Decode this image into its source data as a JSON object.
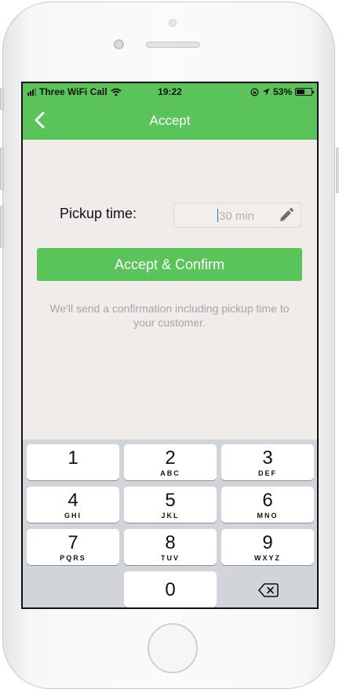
{
  "status_bar": {
    "carrier": "Three WiFi Call",
    "time": "19:22",
    "battery": "53%",
    "battery_level": 0.53,
    "signal_icon": "signal-icon",
    "wifi_icon": "wifi-icon",
    "lock_icon": "orientation-lock-icon",
    "location_icon": "location-arrow-icon"
  },
  "navbar": {
    "title": "Accept",
    "back_icon": "chevron-left-icon"
  },
  "pickup": {
    "label": "Pickup time:",
    "placeholder": "30 min",
    "value": "",
    "edit_icon": "pencil-icon"
  },
  "accept_button": {
    "label": "Accept & Confirm"
  },
  "info_text": "We'll send a confirmation including pickup time to your customer.",
  "keypad": {
    "keys": [
      {
        "num": "1",
        "letters": ""
      },
      {
        "num": "2",
        "letters": "ABC"
      },
      {
        "num": "3",
        "letters": "DEF"
      },
      {
        "num": "4",
        "letters": "GHI"
      },
      {
        "num": "5",
        "letters": "JKL"
      },
      {
        "num": "6",
        "letters": "MNO"
      },
      {
        "num": "7",
        "letters": "PQRS"
      },
      {
        "num": "8",
        "letters": "TUV"
      },
      {
        "num": "9",
        "letters": "WXYZ"
      },
      {
        "num": "0",
        "letters": ""
      }
    ],
    "delete_icon": "backspace-icon"
  },
  "colors": {
    "accent_green": "#5ac35a",
    "screen_background": "#efecea",
    "keypad_background": "#d1d4d9",
    "info_text": "#a8a6a4"
  }
}
